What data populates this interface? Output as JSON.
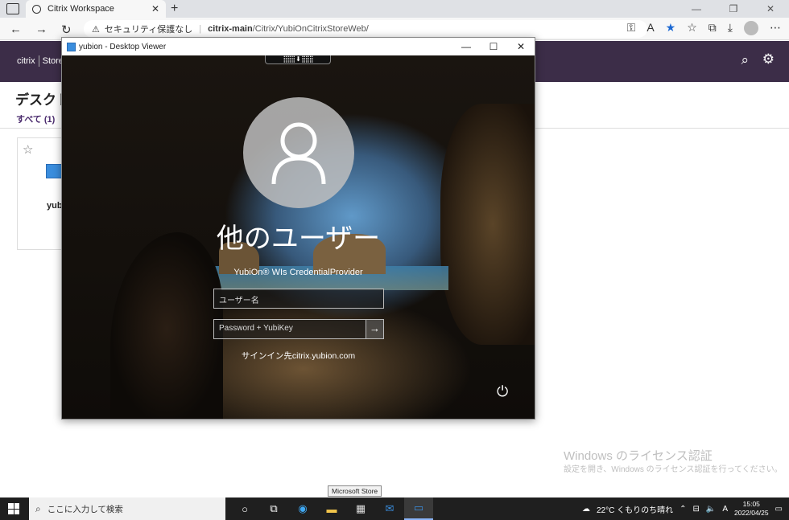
{
  "browser": {
    "tab_title": "Citrix Workspace",
    "tab_close": "✕",
    "new_tab": "+",
    "win_buttons": [
      "—",
      "❐",
      "✕"
    ],
    "security_label": "セキュリティ保護なし",
    "url_host": "citrix-main",
    "url_path": "/Citrix/YubiOnCitrixStoreWeb/"
  },
  "citrix": {
    "logo": "citrix",
    "store_label": "Store",
    "heading": "デスクト",
    "filter_all": "すべて (1)",
    "app_label": "yub"
  },
  "viewer": {
    "title": "yubion - Desktop Viewer",
    "buttons": [
      "—",
      "☐",
      "✕"
    ],
    "conn_bar": "⣿⣿⣿ ⬇ ⣿⣿⣿",
    "user_title": "他のユーザー",
    "provider": "YubiOn® WIs CredentialProvider",
    "username_placeholder": "ユーザー名",
    "password_placeholder": "Password + YubiKey",
    "submit_arrow": "→",
    "signin_to": "サインイン先citrix.yubion.com",
    "power_icon": "⏻"
  },
  "activation": {
    "title": "Windows のライセンス認証",
    "subtitle": "設定を開き、Windows のライセンス認証を行ってください。"
  },
  "tooltip": "Microsoft Store",
  "taskbar": {
    "search_placeholder": "ここに入力して検索",
    "weather": "22°C くもりのち晴れ",
    "time": "15:05",
    "date": "2022/04/25"
  }
}
